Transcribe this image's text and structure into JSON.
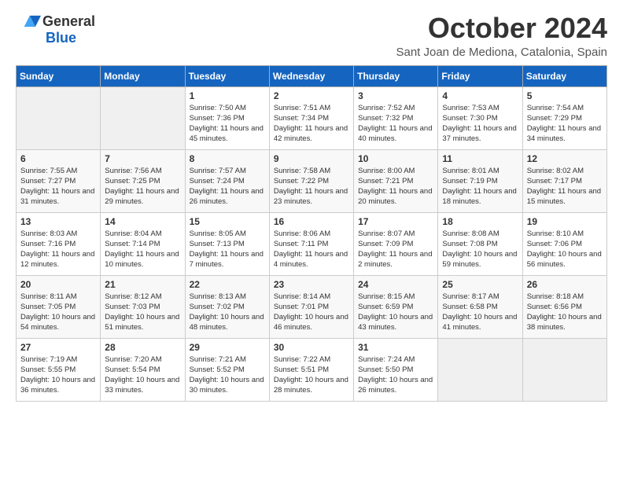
{
  "logo": {
    "general": "General",
    "blue": "Blue"
  },
  "title": "October 2024",
  "location": "Sant Joan de Mediona, Catalonia, Spain",
  "headers": [
    "Sunday",
    "Monday",
    "Tuesday",
    "Wednesday",
    "Thursday",
    "Friday",
    "Saturday"
  ],
  "weeks": [
    [
      {
        "day": "",
        "info": ""
      },
      {
        "day": "",
        "info": ""
      },
      {
        "day": "1",
        "info": "Sunrise: 7:50 AM\nSunset: 7:36 PM\nDaylight: 11 hours and 45 minutes."
      },
      {
        "day": "2",
        "info": "Sunrise: 7:51 AM\nSunset: 7:34 PM\nDaylight: 11 hours and 42 minutes."
      },
      {
        "day": "3",
        "info": "Sunrise: 7:52 AM\nSunset: 7:32 PM\nDaylight: 11 hours and 40 minutes."
      },
      {
        "day": "4",
        "info": "Sunrise: 7:53 AM\nSunset: 7:30 PM\nDaylight: 11 hours and 37 minutes."
      },
      {
        "day": "5",
        "info": "Sunrise: 7:54 AM\nSunset: 7:29 PM\nDaylight: 11 hours and 34 minutes."
      }
    ],
    [
      {
        "day": "6",
        "info": "Sunrise: 7:55 AM\nSunset: 7:27 PM\nDaylight: 11 hours and 31 minutes."
      },
      {
        "day": "7",
        "info": "Sunrise: 7:56 AM\nSunset: 7:25 PM\nDaylight: 11 hours and 29 minutes."
      },
      {
        "day": "8",
        "info": "Sunrise: 7:57 AM\nSunset: 7:24 PM\nDaylight: 11 hours and 26 minutes."
      },
      {
        "day": "9",
        "info": "Sunrise: 7:58 AM\nSunset: 7:22 PM\nDaylight: 11 hours and 23 minutes."
      },
      {
        "day": "10",
        "info": "Sunrise: 8:00 AM\nSunset: 7:21 PM\nDaylight: 11 hours and 20 minutes."
      },
      {
        "day": "11",
        "info": "Sunrise: 8:01 AM\nSunset: 7:19 PM\nDaylight: 11 hours and 18 minutes."
      },
      {
        "day": "12",
        "info": "Sunrise: 8:02 AM\nSunset: 7:17 PM\nDaylight: 11 hours and 15 minutes."
      }
    ],
    [
      {
        "day": "13",
        "info": "Sunrise: 8:03 AM\nSunset: 7:16 PM\nDaylight: 11 hours and 12 minutes."
      },
      {
        "day": "14",
        "info": "Sunrise: 8:04 AM\nSunset: 7:14 PM\nDaylight: 11 hours and 10 minutes."
      },
      {
        "day": "15",
        "info": "Sunrise: 8:05 AM\nSunset: 7:13 PM\nDaylight: 11 hours and 7 minutes."
      },
      {
        "day": "16",
        "info": "Sunrise: 8:06 AM\nSunset: 7:11 PM\nDaylight: 11 hours and 4 minutes."
      },
      {
        "day": "17",
        "info": "Sunrise: 8:07 AM\nSunset: 7:09 PM\nDaylight: 11 hours and 2 minutes."
      },
      {
        "day": "18",
        "info": "Sunrise: 8:08 AM\nSunset: 7:08 PM\nDaylight: 10 hours and 59 minutes."
      },
      {
        "day": "19",
        "info": "Sunrise: 8:10 AM\nSunset: 7:06 PM\nDaylight: 10 hours and 56 minutes."
      }
    ],
    [
      {
        "day": "20",
        "info": "Sunrise: 8:11 AM\nSunset: 7:05 PM\nDaylight: 10 hours and 54 minutes."
      },
      {
        "day": "21",
        "info": "Sunrise: 8:12 AM\nSunset: 7:03 PM\nDaylight: 10 hours and 51 minutes."
      },
      {
        "day": "22",
        "info": "Sunrise: 8:13 AM\nSunset: 7:02 PM\nDaylight: 10 hours and 48 minutes."
      },
      {
        "day": "23",
        "info": "Sunrise: 8:14 AM\nSunset: 7:01 PM\nDaylight: 10 hours and 46 minutes."
      },
      {
        "day": "24",
        "info": "Sunrise: 8:15 AM\nSunset: 6:59 PM\nDaylight: 10 hours and 43 minutes."
      },
      {
        "day": "25",
        "info": "Sunrise: 8:17 AM\nSunset: 6:58 PM\nDaylight: 10 hours and 41 minutes."
      },
      {
        "day": "26",
        "info": "Sunrise: 8:18 AM\nSunset: 6:56 PM\nDaylight: 10 hours and 38 minutes."
      }
    ],
    [
      {
        "day": "27",
        "info": "Sunrise: 7:19 AM\nSunset: 5:55 PM\nDaylight: 10 hours and 36 minutes."
      },
      {
        "day": "28",
        "info": "Sunrise: 7:20 AM\nSunset: 5:54 PM\nDaylight: 10 hours and 33 minutes."
      },
      {
        "day": "29",
        "info": "Sunrise: 7:21 AM\nSunset: 5:52 PM\nDaylight: 10 hours and 30 minutes."
      },
      {
        "day": "30",
        "info": "Sunrise: 7:22 AM\nSunset: 5:51 PM\nDaylight: 10 hours and 28 minutes."
      },
      {
        "day": "31",
        "info": "Sunrise: 7:24 AM\nSunset: 5:50 PM\nDaylight: 10 hours and 26 minutes."
      },
      {
        "day": "",
        "info": ""
      },
      {
        "day": "",
        "info": ""
      }
    ]
  ]
}
